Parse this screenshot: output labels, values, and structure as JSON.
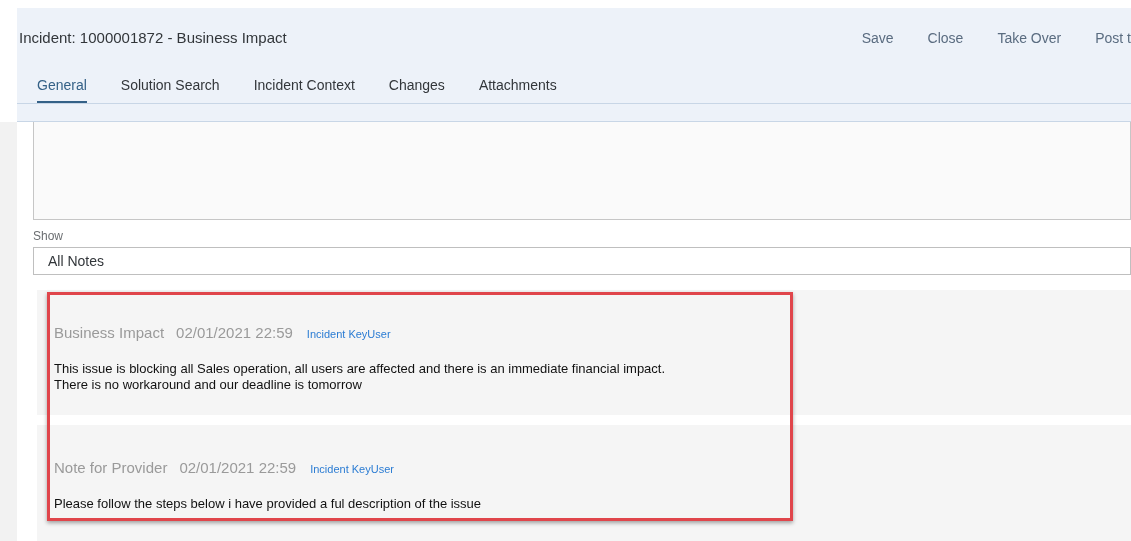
{
  "header": {
    "title": "Incident: 1000001872 - Business Impact",
    "actions": [
      "Save",
      "Close",
      "Take Over",
      "Post t"
    ]
  },
  "tabs": [
    {
      "label": "General",
      "selected": true
    },
    {
      "label": "Solution Search",
      "selected": false
    },
    {
      "label": "Incident Context",
      "selected": false
    },
    {
      "label": "Changes",
      "selected": false
    },
    {
      "label": "Attachments",
      "selected": false
    }
  ],
  "filter": {
    "label": "Show",
    "value": "All Notes"
  },
  "notes": [
    {
      "type": "Business Impact",
      "timestamp": "02/01/2021 22:59",
      "author": "Incident KeyUser",
      "lines": [
        "This issue is blocking all Sales operation, all users are affected and there is an immediate financial impact.",
        "There is no workaround and our deadline is tomorrow"
      ]
    },
    {
      "type": "Note for Provider",
      "timestamp": "02/01/2021 22:59",
      "author": "Incident KeyUser",
      "lines": [
        "Please follow the steps below i have provided a ful description of the issue"
      ]
    }
  ]
}
